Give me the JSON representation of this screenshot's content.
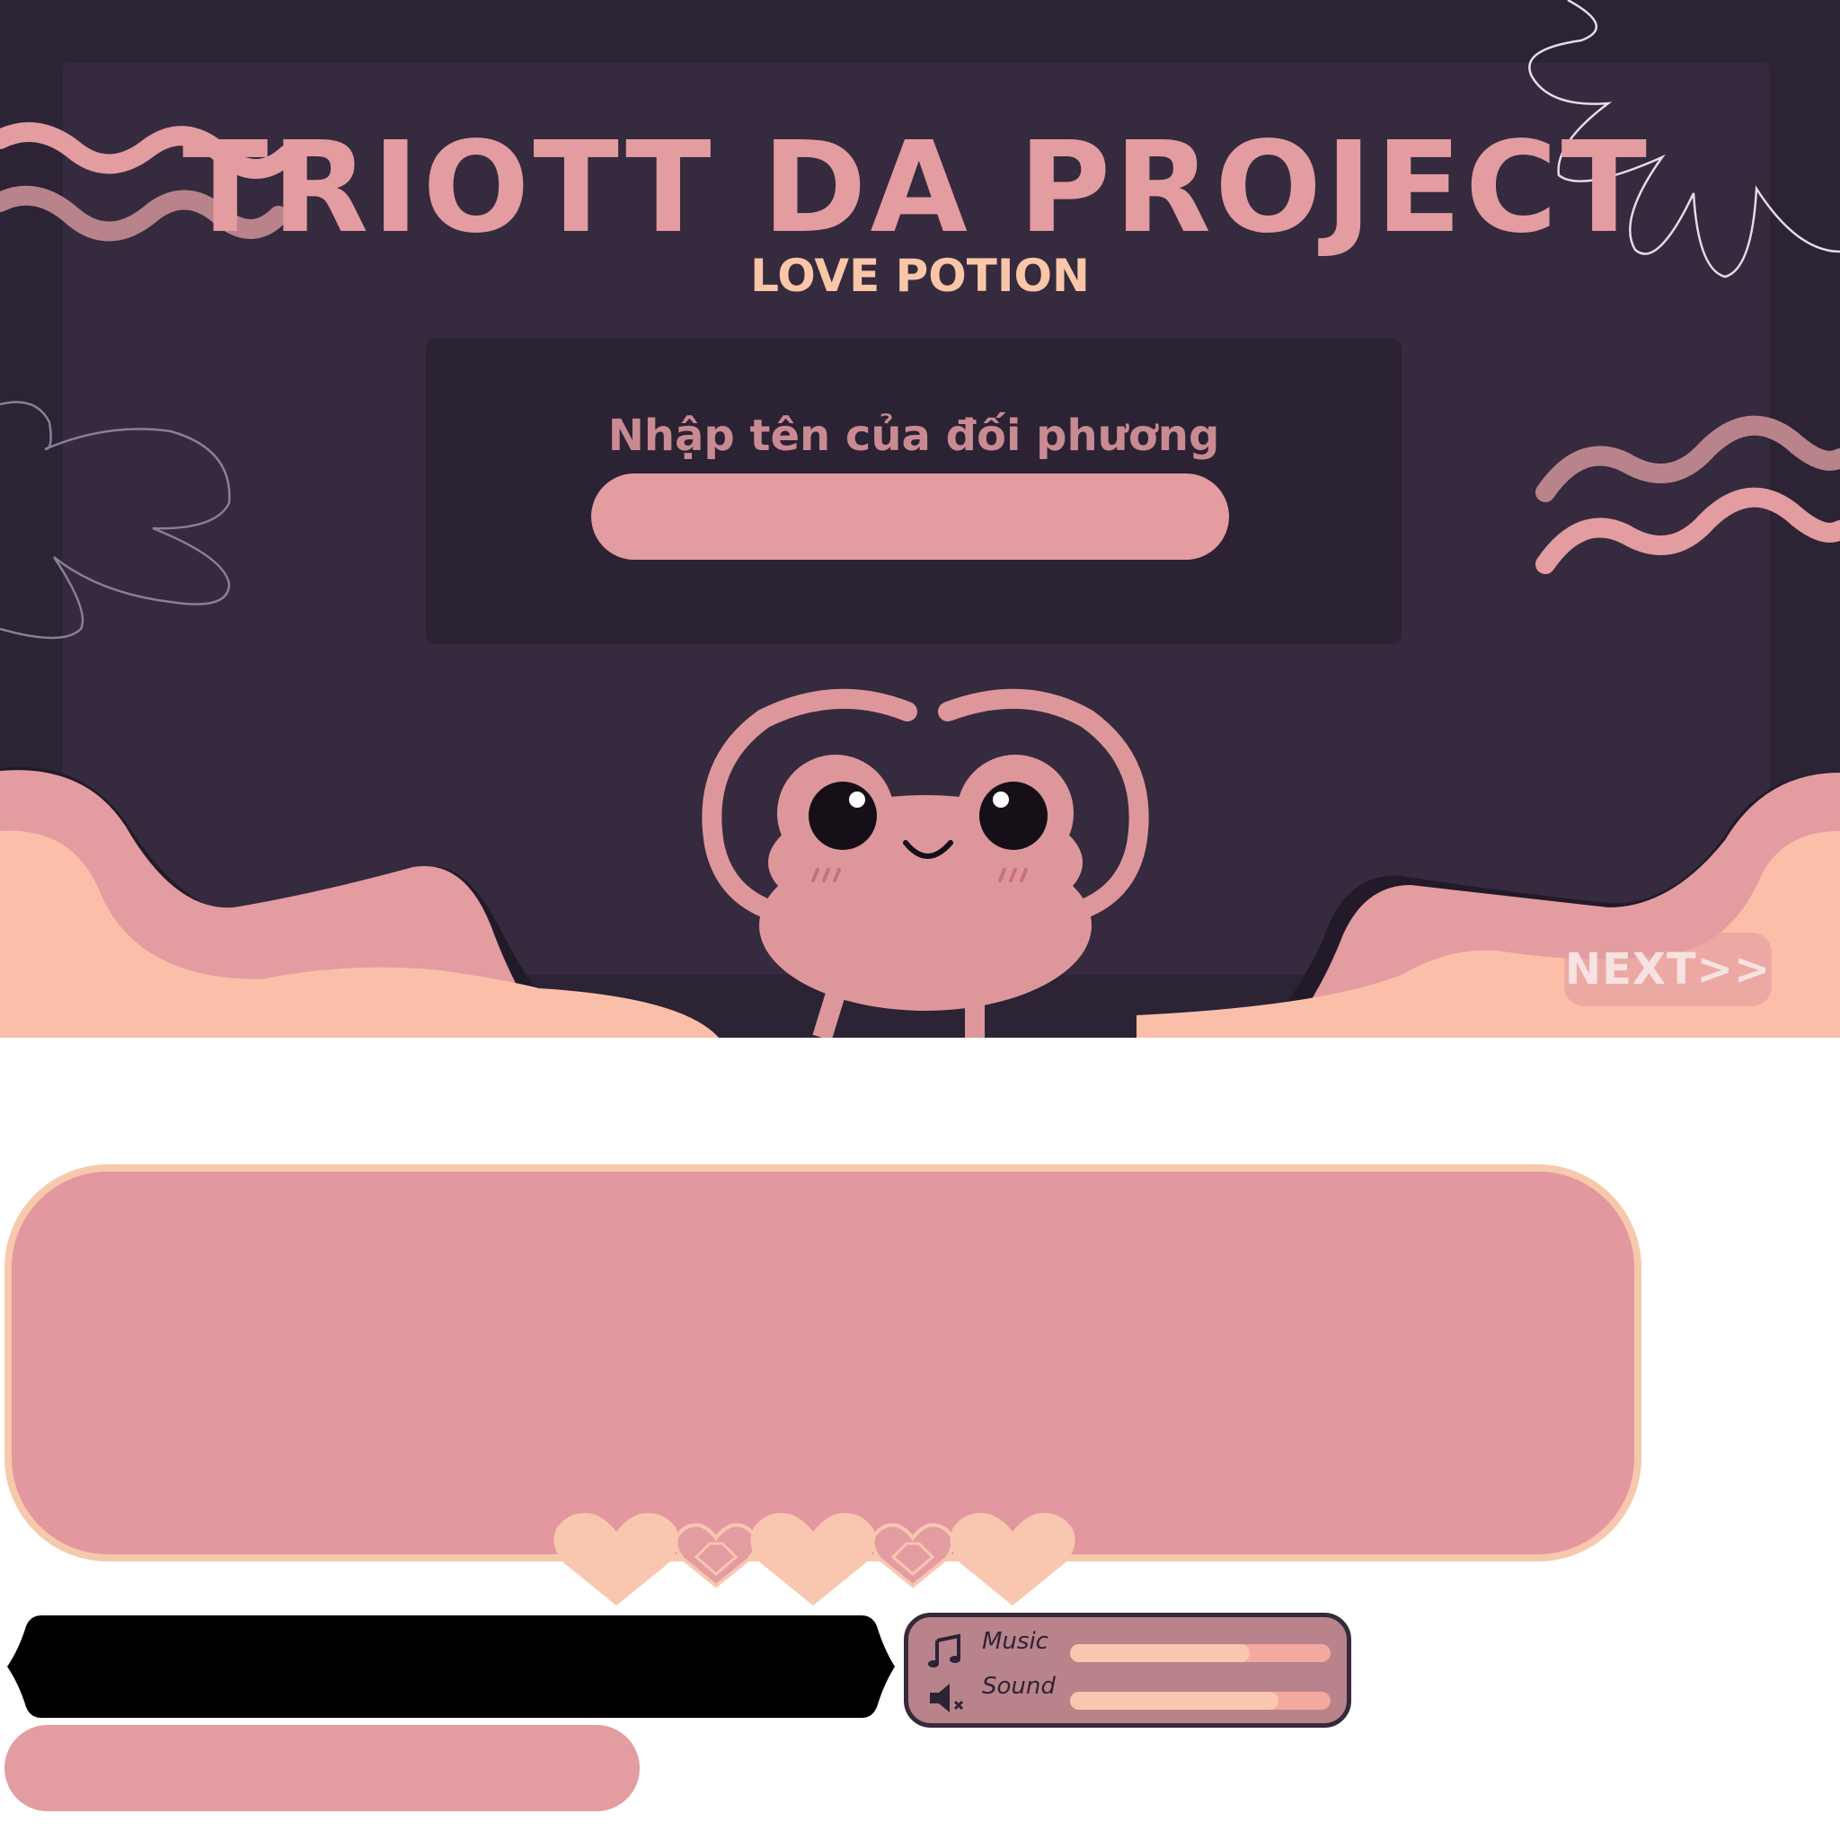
{
  "header": {
    "title": "TRIOTT DA PROJECT",
    "subtitle": "LOVE POTION"
  },
  "name_entry": {
    "prompt": "Nhập tên của đối phương",
    "input_value": ""
  },
  "navigation": {
    "next_label": "NEXT>>"
  },
  "settings": {
    "music": {
      "label": "Music",
      "icon": "music-note-icon",
      "level": 0.69
    },
    "sound": {
      "label": "Sound",
      "icon": "speaker-muted-icon",
      "level": 0.8
    }
  },
  "palette": {
    "background": "#2c2335",
    "panel": "#352a3e",
    "pink": "#e39ca0",
    "peach": "#f9c6a8",
    "mauve": "#b9838c"
  }
}
